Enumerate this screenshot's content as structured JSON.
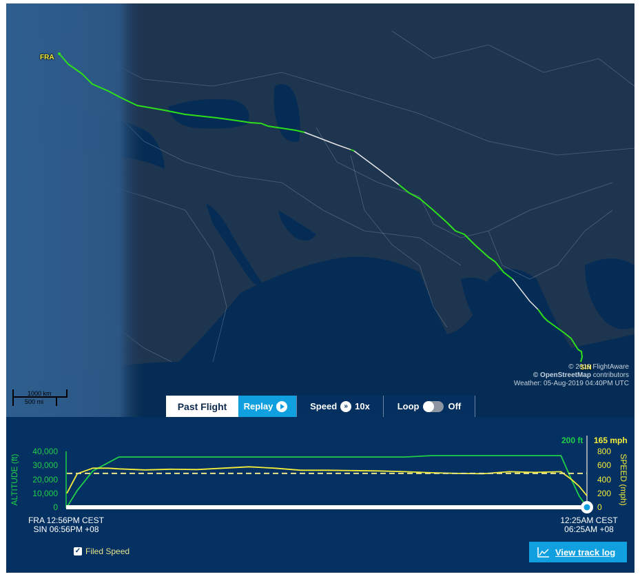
{
  "map": {
    "origin_label": "FRA",
    "destination_label": "SIN",
    "attribution": {
      "line1": "© 2019 FlightAware",
      "line2_bold": "© OpenStreetMap",
      "line2_rest": " contributors",
      "line3": "Weather: 05-Aug-2019 04:40PM UTC"
    },
    "scale": {
      "km": "1000 km",
      "mi": "500 mi"
    },
    "colors": {
      "track": "#2de01a",
      "estimated_track": "#e6e6e6",
      "land": "#1e3550",
      "water": "#042c54",
      "daylight": "#2f5f8f"
    }
  },
  "toolbar": {
    "past_flight": "Past Flight",
    "replay": "Replay",
    "speed_label": "Speed",
    "speed_value": "10x",
    "loop_label": "Loop",
    "loop_state": "Off"
  },
  "profile": {
    "altitude_ticks": [
      "40,000",
      "30,000",
      "20,000",
      "10,000",
      "0"
    ],
    "speed_ticks": [
      "800",
      "600",
      "400",
      "200",
      "0"
    ],
    "altitude_axis_title": "ALTITUDE (ft)",
    "speed_axis_title": "SPEED (mph)",
    "current_altitude": "200 ft",
    "current_speed": "165 mph",
    "start_time": {
      "line1": "FRA 12:56PM CEST",
      "line2": "SIN 06:56PM +08"
    },
    "end_time": {
      "line1": "12:25AM CEST",
      "line2": "06:25AM +08"
    },
    "playback_progress": 1.0,
    "filed_speed_label": "Filed Speed",
    "filed_speed_checked": true,
    "view_track_log": "View track log",
    "colors": {
      "altitude": "#1ed047",
      "speed": "#f5ef3a",
      "filed_speed": "#e9e48a",
      "bg": "#043062",
      "button": "#10a0e0"
    }
  },
  "chart_data": {
    "type": "line",
    "title": "",
    "xlabel": "",
    "x_range_labels": [
      "FRA 12:56PM CEST / SIN 06:56PM +08",
      "12:25AM CEST / 06:25AM +08"
    ],
    "x": [
      0,
      0.02,
      0.05,
      0.08,
      0.1,
      0.15,
      0.2,
      0.25,
      0.3,
      0.35,
      0.4,
      0.45,
      0.5,
      0.55,
      0.6,
      0.65,
      0.7,
      0.75,
      0.8,
      0.85,
      0.9,
      0.95,
      0.97,
      0.985,
      1.0
    ],
    "series": [
      {
        "name": "Altitude (ft)",
        "axis": "left",
        "values": [
          0,
          12000,
          26000,
          32000,
          36000,
          36000,
          36000,
          36000,
          36000,
          36000,
          36000,
          36000,
          36000,
          36000,
          36000,
          36000,
          37000,
          37000,
          37000,
          37000,
          37000,
          37000,
          20000,
          8000,
          200
        ]
      },
      {
        "name": "Speed (mph)",
        "axis": "right",
        "values": [
          200,
          480,
          560,
          560,
          550,
          535,
          545,
          540,
          560,
          580,
          560,
          530,
          530,
          525,
          520,
          510,
          495,
          485,
          480,
          510,
          500,
          510,
          400,
          300,
          165
        ]
      },
      {
        "name": "Filed Speed (mph)",
        "axis": "right",
        "style": "dashed",
        "values": [
          485,
          485,
          485,
          485,
          485,
          485,
          485,
          485,
          485,
          485,
          485,
          485,
          485,
          485,
          485,
          485,
          485,
          485,
          485,
          485,
          485,
          485,
          485,
          485,
          485
        ]
      }
    ],
    "ylabel_left": "ALTITUDE (ft)",
    "ylim_left": [
      0,
      40000
    ],
    "ylabel_right": "SPEED (mph)",
    "ylim_right": [
      0,
      800
    ],
    "legend": [
      "Filed Speed"
    ]
  }
}
